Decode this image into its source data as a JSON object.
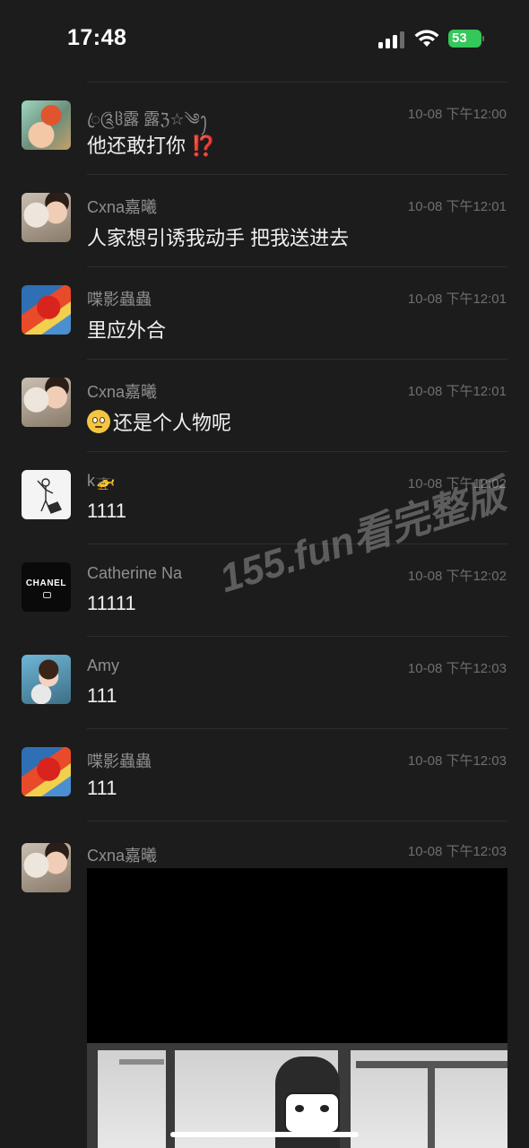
{
  "status_bar": {
    "time": "17:48",
    "battery_level": "53"
  },
  "messages": [
    {
      "name": "ꦿ༊ჱ露 露ℨ☆༄ꫂ",
      "timestamp": "10-08 下午12:00",
      "text": "他还敢打你",
      "emoji": "⁉️",
      "avatar_icon": "user-avatar-icon"
    },
    {
      "name": "Cxna嘉曦",
      "timestamp": "10-08 下午12:01",
      "text": "人家想引诱我动手 把我送进去",
      "avatar_icon": "user-avatar-icon"
    },
    {
      "name": "喋影蟲蟲",
      "timestamp": "10-08 下午12:01",
      "text": "里应外合",
      "avatar_icon": "user-avatar-icon"
    },
    {
      "name": "Cxna嘉曦",
      "timestamp": "10-08 下午12:01",
      "text": "还是个人物呢",
      "emoji": "😳",
      "avatar_icon": "user-avatar-icon"
    },
    {
      "name": "k🚁",
      "timestamp": "10-08 下午12:02",
      "text": "1111",
      "avatar_icon": "user-avatar-icon"
    },
    {
      "name": "Catherine Na",
      "timestamp": "10-08 下午12:02",
      "text": "11111",
      "avatar_label": "CHANEL",
      "avatar_icon": "chanel-logo-icon"
    },
    {
      "name": "Amy",
      "timestamp": "10-08 下午12:03",
      "text": "111",
      "avatar_icon": "user-avatar-icon"
    },
    {
      "name": "喋影蟲蟲",
      "timestamp": "10-08 下午12:03",
      "text": "111",
      "avatar_icon": "user-avatar-icon"
    }
  ],
  "image_message": {
    "name": "Cxna嘉曦",
    "timestamp": "10-08 下午12:03"
  },
  "watermark": "155.fun看完整版",
  "colors": {
    "background": "#1c1c1c",
    "name_text": "#8f8f8f",
    "timestamp_text": "#6f6f6f",
    "message_text": "#efefef",
    "battery": "#34c759"
  }
}
